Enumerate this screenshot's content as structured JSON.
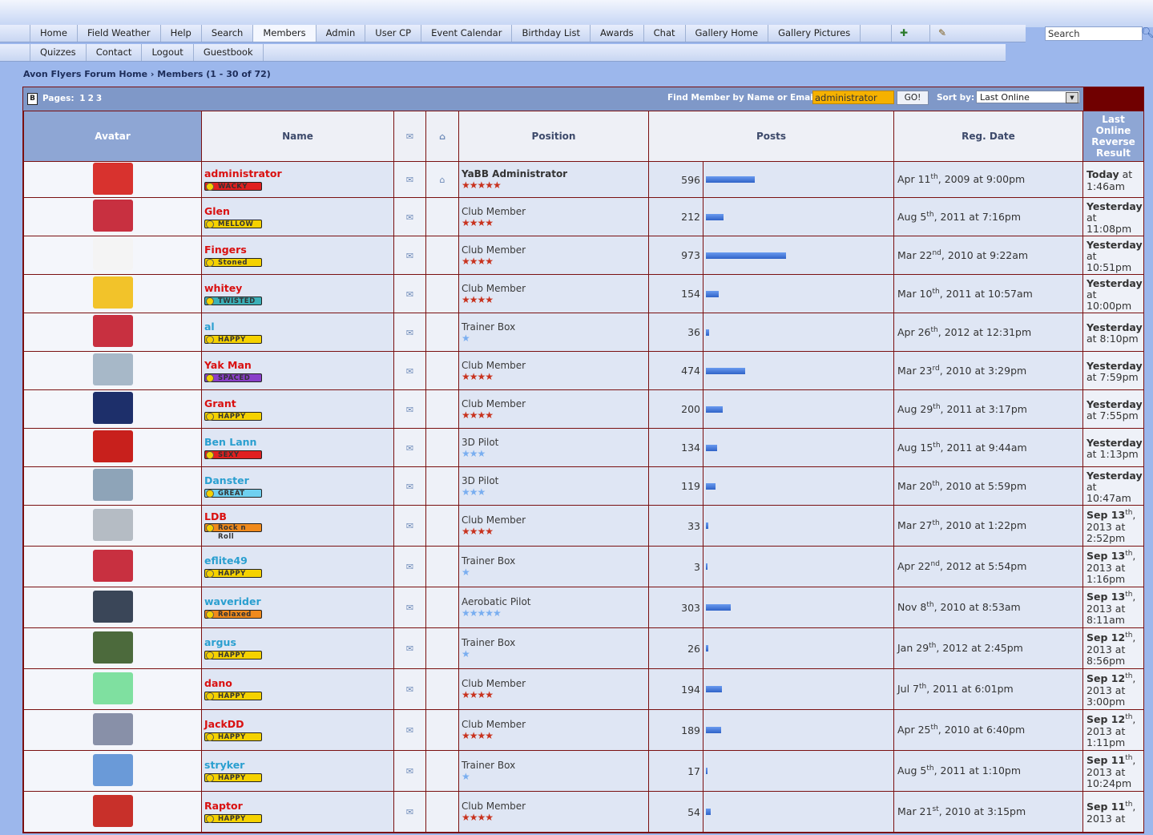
{
  "nav": {
    "row1": [
      "Home",
      "Field Weather",
      "Help",
      "Search",
      "Members",
      "Admin",
      "User CP",
      "Event Calendar",
      "Birthday List",
      "Awards",
      "Chat",
      "Gallery Home",
      "Gallery Pictures"
    ],
    "row2": [
      "Quizzes",
      "Contact",
      "Logout",
      "Guestbook"
    ],
    "active": "Members",
    "search_value": "Search"
  },
  "breadcrumb": "Avon Flyers Forum Home › Members (1 - 30 of 72)",
  "pager": {
    "label": "Pages:",
    "pages": [
      "1",
      "2",
      "3"
    ],
    "find_label": "Find Member by Name or Email:",
    "find_value": "administrator",
    "go_label": "GO!",
    "sort_label": "Sort by:",
    "sort_value": "Last Online"
  },
  "columns": {
    "avatar": "Avatar",
    "name": "Name",
    "position": "Position",
    "posts": "Posts",
    "reg_date": "Reg. Date",
    "last_online": "Last Online Reverse Result"
  },
  "max_posts": 973,
  "members": [
    {
      "name": "administrator",
      "name_color": "#d91010",
      "mood": "WACKY",
      "mood_color": "#e02020",
      "position": "YaBB Administrator",
      "admin": true,
      "stars": 5,
      "star_color": "red",
      "posts": 596,
      "reg": "Apr 11",
      "reg_suf": "th",
      "reg_rest": ", 2009 at 9:00pm",
      "last1": "Today",
      "last2": " at 1:46am",
      "last_sup": "",
      "last_rest": "",
      "avatar_color": "#d8322e",
      "web": true
    },
    {
      "name": "Glen",
      "name_color": "#d91010",
      "mood": "MELLOW",
      "mood_color": "#f5d200",
      "position": "Club Member",
      "admin": false,
      "stars": 4,
      "star_color": "red",
      "posts": 212,
      "reg": "Aug 5",
      "reg_suf": "th",
      "reg_rest": ", 2011 at 7:16pm",
      "last1": "Yesterday",
      "last2": " at 11:08pm",
      "last_sup": "",
      "last_rest": "",
      "avatar_color": "#c83040",
      "web": false
    },
    {
      "name": "Fingers",
      "name_color": "#d91010",
      "mood": "Stoned",
      "mood_color": "#f5d200",
      "position": "Club Member",
      "admin": false,
      "stars": 4,
      "star_color": "red",
      "posts": 973,
      "reg": "Mar 22",
      "reg_suf": "nd",
      "reg_rest": ", 2010 at 9:22am",
      "last1": "Yesterday",
      "last2": " at 10:51pm",
      "last_sup": "",
      "last_rest": "",
      "avatar_color": "#f4f4f4",
      "web": false
    },
    {
      "name": "whitey",
      "name_color": "#d91010",
      "mood": "TWISTED",
      "mood_color": "#3bb0b8",
      "position": "Club Member",
      "admin": false,
      "stars": 4,
      "star_color": "red",
      "posts": 154,
      "reg": "Mar 10",
      "reg_suf": "th",
      "reg_rest": ", 2011 at 10:57am",
      "last1": "Yesterday",
      "last2": " at 10:00pm",
      "last_sup": "",
      "last_rest": "",
      "avatar_color": "#f2c32a",
      "web": false
    },
    {
      "name": "al",
      "name_color": "#2a9fd0",
      "mood": "HAPPY",
      "mood_color": "#f5d200",
      "position": "Trainer Box",
      "admin": false,
      "stars": 1,
      "star_color": "blue",
      "posts": 36,
      "reg": "Apr 26",
      "reg_suf": "th",
      "reg_rest": ", 2012 at 12:31pm",
      "last1": "Yesterday",
      "last2": " at 8:10pm",
      "last_sup": "",
      "last_rest": "",
      "avatar_color": "#c83040",
      "web": false
    },
    {
      "name": "Yak Man",
      "name_color": "#d91010",
      "mood": "SPACED",
      "mood_color": "#8a3fc9",
      "position": "Club Member",
      "admin": false,
      "stars": 4,
      "star_color": "red",
      "posts": 474,
      "reg": "Mar 23",
      "reg_suf": "rd",
      "reg_rest": ", 2010 at 3:29pm",
      "last1": "Yesterday",
      "last2": " at 7:59pm",
      "last_sup": "",
      "last_rest": "",
      "avatar_color": "#a7b8c8",
      "web": false
    },
    {
      "name": "Grant",
      "name_color": "#d91010",
      "mood": "HAPPY",
      "mood_color": "#f5d200",
      "position": "Club Member",
      "admin": false,
      "stars": 4,
      "star_color": "red",
      "posts": 200,
      "reg": "Aug 29",
      "reg_suf": "th",
      "reg_rest": ", 2011 at 3:17pm",
      "last1": "Yesterday",
      "last2": " at 7:55pm",
      "last_sup": "",
      "last_rest": "",
      "avatar_color": "#1d2f6a",
      "web": false
    },
    {
      "name": "Ben Lann",
      "name_color": "#2a9fd0",
      "mood": "SEXY",
      "mood_color": "#e02020",
      "position": "3D Pilot",
      "admin": false,
      "stars": 3,
      "star_color": "blue",
      "posts": 134,
      "reg": "Aug 15",
      "reg_suf": "th",
      "reg_rest": ", 2011 at 9:44am",
      "last1": "Yesterday",
      "last2": " at 1:13pm",
      "last_sup": "",
      "last_rest": "",
      "avatar_color": "#c8201c",
      "web": false
    },
    {
      "name": "Danster",
      "name_color": "#2a9fd0",
      "mood": "GREAT",
      "mood_color": "#6fd0f0",
      "position": "3D Pilot",
      "admin": false,
      "stars": 3,
      "star_color": "blue",
      "posts": 119,
      "reg": "Mar 20",
      "reg_suf": "th",
      "reg_rest": ", 2010 at 5:59pm",
      "last1": "Yesterday",
      "last2": " at 10:47am",
      "last_sup": "",
      "last_rest": "",
      "avatar_color": "#8ea4b8",
      "web": false
    },
    {
      "name": "LDB",
      "name_color": "#d91010",
      "mood": "Rock n Roll",
      "mood_color": "#f08a1c",
      "position": "Club Member",
      "admin": false,
      "stars": 4,
      "star_color": "red",
      "posts": 33,
      "reg": "Mar 27",
      "reg_suf": "th",
      "reg_rest": ", 2010 at 1:22pm",
      "last1": "Sep 13",
      "last2": ", 2013 at 2:52pm",
      "last_sup": "th",
      "last_rest": "",
      "avatar_color": "#b5bcc4",
      "web": false
    },
    {
      "name": "eflite49",
      "name_color": "#2a9fd0",
      "mood": "HAPPY",
      "mood_color": "#f5d200",
      "position": "Trainer Box",
      "admin": false,
      "stars": 1,
      "star_color": "blue",
      "posts": 3,
      "reg": "Apr 22",
      "reg_suf": "nd",
      "reg_rest": ", 2012 at 5:54pm",
      "last1": "Sep 13",
      "last2": ", 2013 at 1:16pm",
      "last_sup": "th",
      "last_rest": "",
      "avatar_color": "#c83040",
      "web": false
    },
    {
      "name": "waverider",
      "name_color": "#2a9fd0",
      "mood": "Relaxed",
      "mood_color": "#f08a1c",
      "position": "Aerobatic Pilot",
      "admin": false,
      "stars": 5,
      "star_color": "blue",
      "posts": 303,
      "reg": "Nov 8",
      "reg_suf": "th",
      "reg_rest": ", 2010 at 8:53am",
      "last1": "Sep 13",
      "last2": ", 2013 at 8:11am",
      "last_sup": "th",
      "last_rest": "",
      "avatar_color": "#3a4658",
      "web": false
    },
    {
      "name": "argus",
      "name_color": "#2a9fd0",
      "mood": "HAPPY",
      "mood_color": "#f5d200",
      "position": "Trainer Box",
      "admin": false,
      "stars": 1,
      "star_color": "blue",
      "posts": 26,
      "reg": "Jan 29",
      "reg_suf": "th",
      "reg_rest": ", 2012 at 2:45pm",
      "last1": "Sep 12",
      "last2": ", 2013 at 8:56pm",
      "last_sup": "th",
      "last_rest": "",
      "avatar_color": "#4c6a3c",
      "web": false
    },
    {
      "name": "dano",
      "name_color": "#d91010",
      "mood": "HAPPY",
      "mood_color": "#f5d200",
      "position": "Club Member",
      "admin": false,
      "stars": 4,
      "star_color": "red",
      "posts": 194,
      "reg": "Jul 7",
      "reg_suf": "th",
      "reg_rest": ", 2011 at 6:01pm",
      "last1": "Sep 12",
      "last2": ", 2013 at 3:00pm",
      "last_sup": "th",
      "last_rest": "",
      "avatar_color": "#7fe0a0",
      "web": false
    },
    {
      "name": "JackDD",
      "name_color": "#d91010",
      "mood": "HAPPY",
      "mood_color": "#f5d200",
      "position": "Club Member",
      "admin": false,
      "stars": 4,
      "star_color": "red",
      "posts": 189,
      "reg": "Apr 25",
      "reg_suf": "th",
      "reg_rest": ", 2010 at 6:40pm",
      "last1": "Sep 12",
      "last2": ", 2013 at 1:11pm",
      "last_sup": "th",
      "last_rest": "",
      "avatar_color": "#8890a8",
      "web": false
    },
    {
      "name": "stryker",
      "name_color": "#2a9fd0",
      "mood": "HAPPY",
      "mood_color": "#f5d200",
      "position": "Trainer Box",
      "admin": false,
      "stars": 1,
      "star_color": "blue",
      "posts": 17,
      "reg": "Aug 5",
      "reg_suf": "th",
      "reg_rest": ", 2011 at 1:10pm",
      "last1": "Sep 11",
      "last2": ", 2013 at 10:24pm",
      "last_sup": "th",
      "last_rest": "",
      "avatar_color": "#6a9ad8",
      "web": false
    },
    {
      "name": "Raptor",
      "name_color": "#d91010",
      "mood": "HAPPY",
      "mood_color": "#f5d200",
      "position": "Club Member",
      "admin": false,
      "stars": 4,
      "star_color": "red",
      "posts": 54,
      "reg": "Mar 21",
      "reg_suf": "st",
      "reg_rest": ", 2010 at 3:15pm",
      "last1": "Sep 11",
      "last2": ", 2013 at",
      "last_sup": "th",
      "last_rest": "",
      "avatar_color": "#c8302a",
      "web": false
    }
  ]
}
